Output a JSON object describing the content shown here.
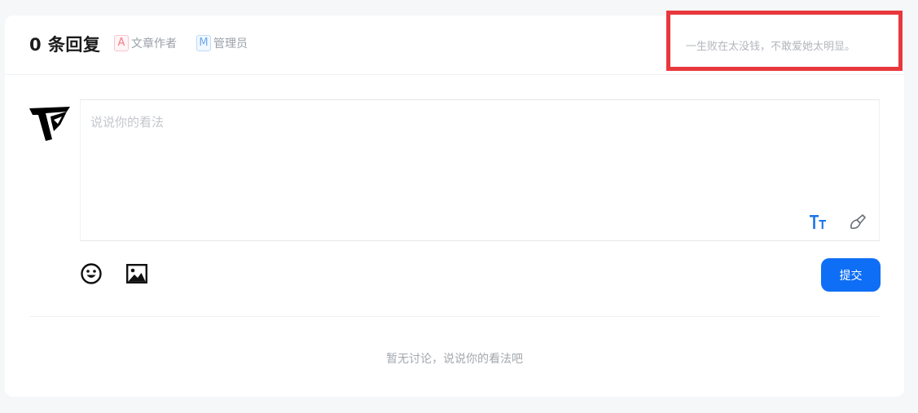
{
  "header": {
    "reply_count": "0 条回复",
    "author_badge": "A",
    "author_label": "文章作者",
    "admin_badge": "M",
    "admin_label": "管理员",
    "quote": "一生败在太没钱，不敢爱她太明显。"
  },
  "editor": {
    "placeholder": "说说你的看法"
  },
  "toolbar": {
    "emoji_icon": "emoji-icon",
    "image_icon": "image-icon",
    "font_icon": "text-size-icon",
    "brush_icon": "brush-icon",
    "submit_label": "提交"
  },
  "empty_state": {
    "text": "暂无讨论，说说你的看法吧"
  },
  "colors": {
    "accent": "#0e6ef5",
    "highlight": "#e8383d"
  }
}
